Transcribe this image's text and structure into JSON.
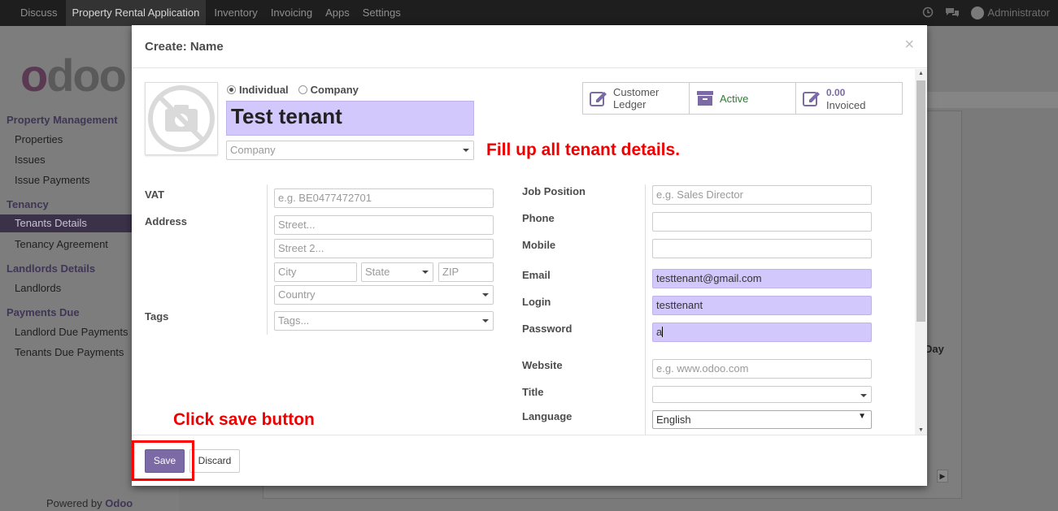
{
  "navbar": {
    "items": [
      "Discuss",
      "Property Rental Application",
      "Inventory",
      "Invoicing",
      "Apps",
      "Settings"
    ],
    "user": "Administrator"
  },
  "logo": "odoo",
  "sidebar": {
    "sections": [
      {
        "title": "Property Management",
        "items": [
          "Properties",
          "Issues",
          "Issue Payments"
        ]
      },
      {
        "title": "Tenancy",
        "items": [
          "Tenants Details",
          "Tenancy Agreement"
        ]
      },
      {
        "title": "Landlords Details",
        "items": [
          "Landlords"
        ]
      },
      {
        "title": "Payments Due",
        "items": [
          "Landlord Due Payments",
          "Tenants Due Payments"
        ]
      }
    ],
    "active_item": "Tenants Details",
    "powered_prefix": "Powered by",
    "powered_brand": "Odoo"
  },
  "background": {
    "column_header": "Day"
  },
  "modal": {
    "title": "Create: Name",
    "close_symbol": "×",
    "type_options": [
      "Individual",
      "Company"
    ],
    "selected_type": "Individual",
    "name_value": "Test tenant",
    "company_placeholder": "Company",
    "stats": [
      {
        "line1": "Customer",
        "line2": "Ledger",
        "icon": "edit-icon"
      },
      {
        "line1": "Active",
        "line2": "",
        "icon": "archive-icon"
      },
      {
        "line1": "0.00",
        "line2": "Invoiced",
        "icon": "edit-icon"
      }
    ],
    "left_fields": {
      "vat_label": "VAT",
      "vat_placeholder": "e.g. BE0477472701",
      "address_label": "Address",
      "street_placeholder": "Street...",
      "street2_placeholder": "Street 2...",
      "city_placeholder": "City",
      "state_placeholder": "State",
      "zip_placeholder": "ZIP",
      "country_placeholder": "Country",
      "tags_label": "Tags",
      "tags_placeholder": "Tags..."
    },
    "right_fields": {
      "job_label": "Job Position",
      "job_placeholder": "e.g. Sales Director",
      "phone_label": "Phone",
      "phone_value": "",
      "mobile_label": "Mobile",
      "mobile_value": "",
      "email_label": "Email",
      "email_value": "testtenant@gmail.com",
      "login_label": "Login",
      "login_value": "testtenant",
      "password_label": "Password",
      "password_value": "a",
      "website_label": "Website",
      "website_placeholder": "e.g. www.odoo.com",
      "title_label": "Title",
      "title_value": "",
      "language_label": "Language",
      "language_value": "English"
    },
    "save_label": "Save",
    "discard_label": "Discard"
  },
  "annotations": {
    "fill_hint": "Fill up all tenant details.",
    "save_hint": "Click save button"
  },
  "colors": {
    "accent": "#7c6aa6",
    "required_field": "#d2c8fc",
    "annotation": "#ff0000"
  }
}
